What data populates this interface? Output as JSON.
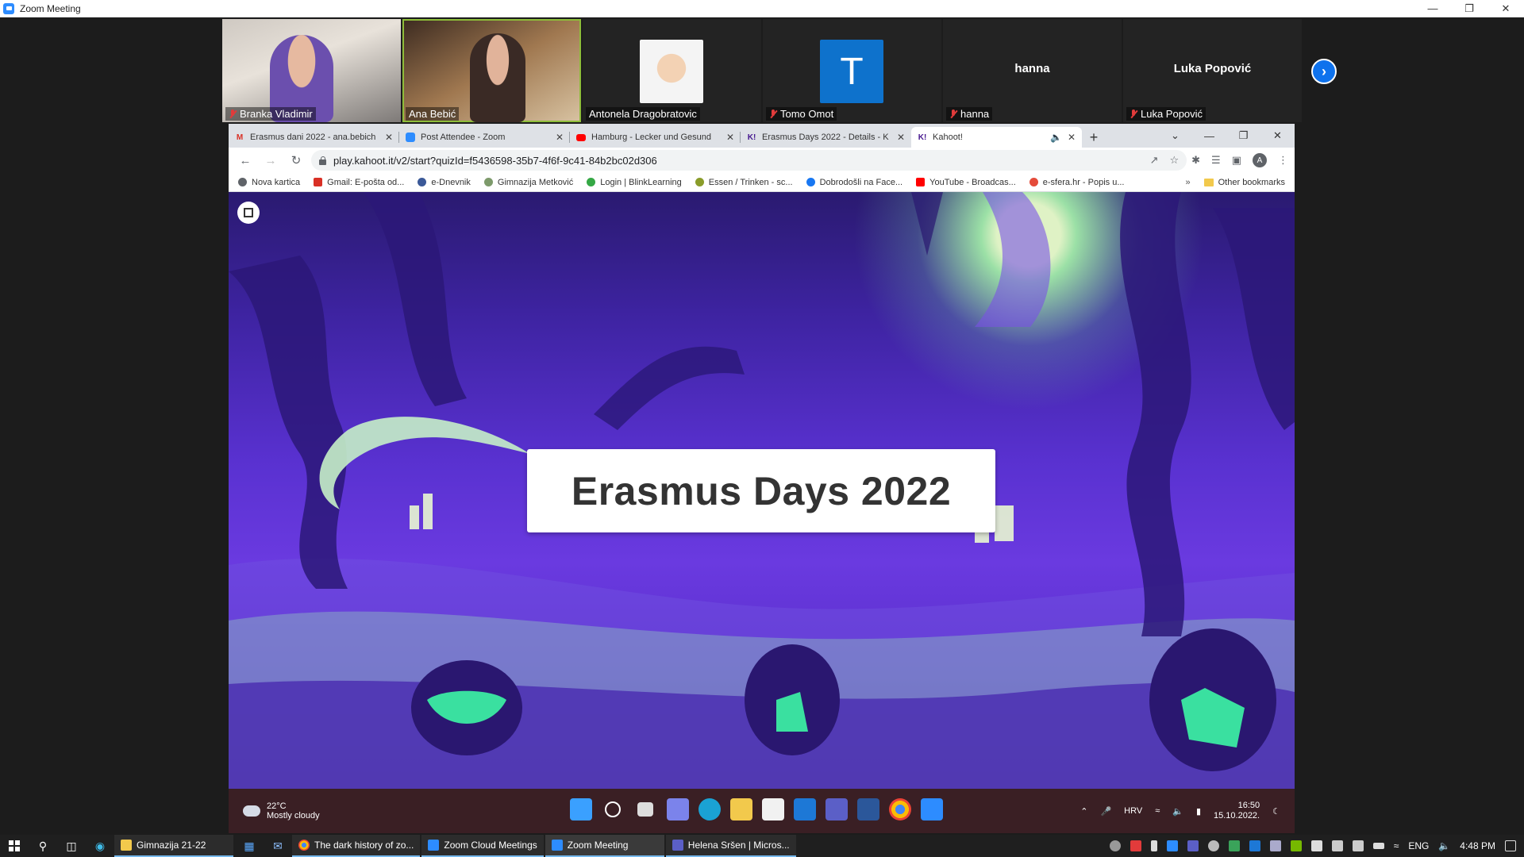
{
  "zoom": {
    "window_title": "Zoom Meeting"
  },
  "participants": [
    {
      "name": "Branka Vladimir",
      "muted": true,
      "type": "video"
    },
    {
      "name": "Ana Bebić",
      "muted": false,
      "type": "video"
    },
    {
      "name": "Antonela Dragobratovic",
      "muted": false,
      "type": "avatar"
    },
    {
      "name": "Tomo Omot",
      "muted": true,
      "type": "letter",
      "letter": "T"
    },
    {
      "name": "hanna",
      "muted": true,
      "type": "name"
    },
    {
      "name": "Luka Popović",
      "muted": true,
      "type": "name"
    }
  ],
  "browser": {
    "tabs": [
      {
        "title": "Erasmus dani 2022 - ana.bebich",
        "icon": "gmail-icon",
        "color": "#d93025"
      },
      {
        "title": "Post Attendee - Zoom",
        "icon": "zoom-icon",
        "color": "#2d8cff"
      },
      {
        "title": "Hamburg - Lecker und Gesund",
        "icon": "youtube-icon",
        "color": "#ff0000"
      },
      {
        "title": "Erasmus Days 2022 - Details - K",
        "icon": "kahoot-icon",
        "color": "#46178f"
      },
      {
        "title": "Kahoot!",
        "icon": "kahoot-icon",
        "color": "#46178f"
      }
    ],
    "url": "play.kahoot.it/v2/start?quizId=f5436598-35b7-4f6f-9c41-84b2bc02d306",
    "bookmarks": [
      {
        "label": "Nova kartica",
        "color": "#5f6368"
      },
      {
        "label": "Gmail: E-pošta od...",
        "color": "#d93025"
      },
      {
        "label": "e-Dnevnik",
        "color": "#3b5998"
      },
      {
        "label": "Gimnazija Metković",
        "color": "#7d9a6b"
      },
      {
        "label": "Login | BlinkLearning",
        "color": "#35a845"
      },
      {
        "label": "Essen / Trinken - sc...",
        "color": "#8a9c2a"
      },
      {
        "label": "Dobrodošli na Face...",
        "color": "#1877f2"
      },
      {
        "label": "YouTube - Broadcas...",
        "color": "#ff0000"
      },
      {
        "label": "e-sfera.hr - Popis u...",
        "color": "#e44b3a"
      }
    ],
    "bookmarks_more": "»",
    "other_bookmarks": "Other bookmarks",
    "profile_letter": "A"
  },
  "kahoot": {
    "title": "Erasmus Days 2022"
  },
  "shared_taskbar": {
    "temperature": "22°C",
    "weather": "Mostly cloudy",
    "language": "HRV",
    "time": "16:50",
    "date": "15.10.2022."
  },
  "host_taskbar": {
    "items": [
      {
        "label": "Gimnazija 21-22",
        "color": "#f2c94c"
      },
      {
        "label": "The dark history of zo...",
        "color": "#4285f4"
      },
      {
        "label": "Zoom Cloud Meetings",
        "color": "#2d8cff"
      },
      {
        "label": "Zoom Meeting",
        "color": "#2d8cff"
      },
      {
        "label": "Helena Sršen | Micros...",
        "color": "#5b5fc7"
      }
    ],
    "language": "ENG",
    "time": "4:48 PM"
  }
}
